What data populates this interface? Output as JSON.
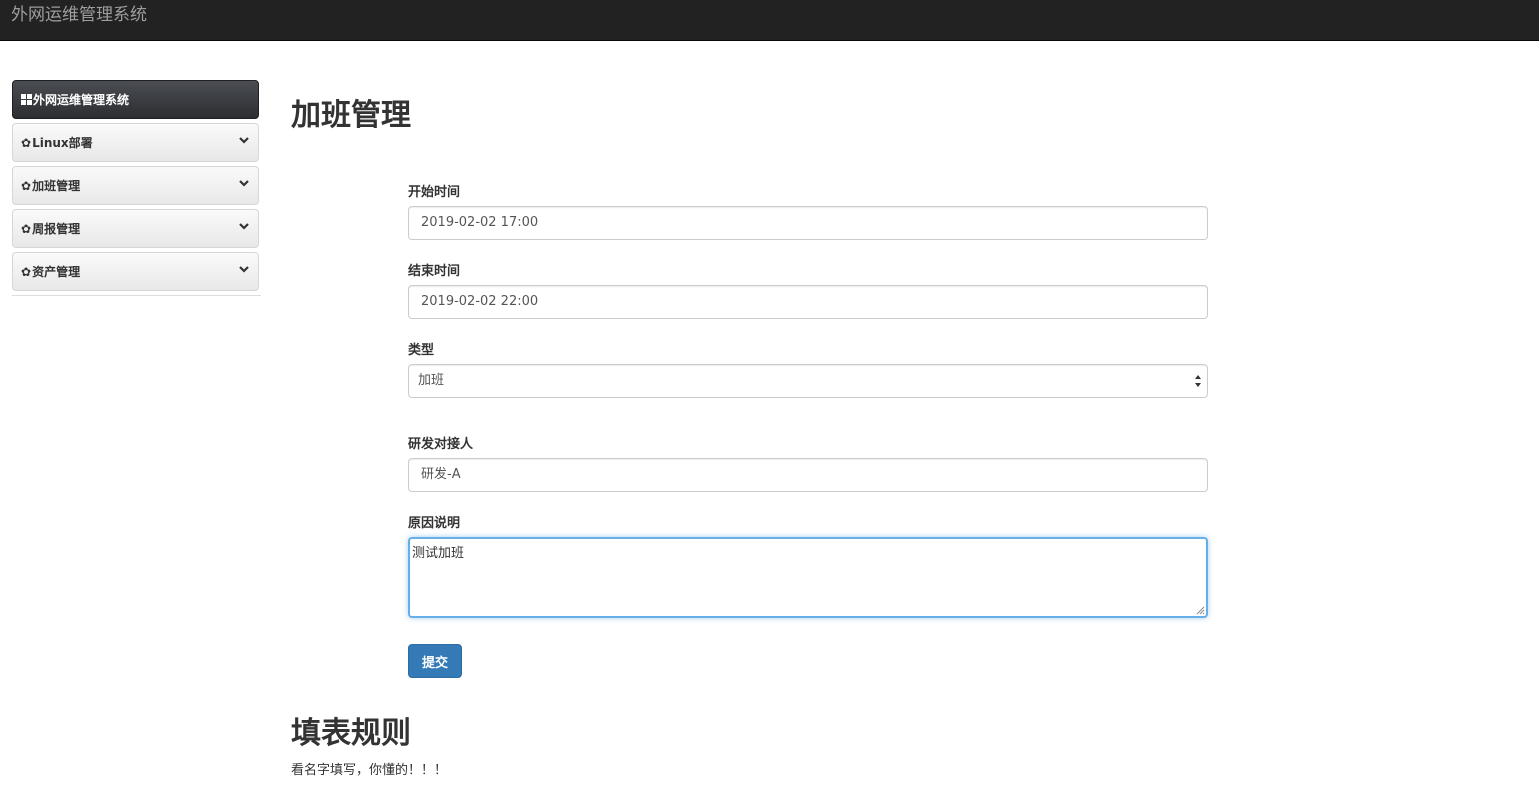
{
  "navbar": {
    "brand": "外网运维管理系统"
  },
  "sidebar": {
    "header": {
      "icon": "grid-icon",
      "label": "外网运维管理系统"
    },
    "items": [
      {
        "icon": "gear-icon",
        "label": "Linux部署",
        "chevron": "chevron-down-icon"
      },
      {
        "icon": "gear-icon",
        "label": "加班管理",
        "chevron": "chevron-down-icon"
      },
      {
        "icon": "gear-icon",
        "label": "周报管理",
        "chevron": "chevron-down-icon"
      },
      {
        "icon": "gear-icon",
        "label": "资产管理",
        "chevron": "chevron-down-icon"
      }
    ]
  },
  "main": {
    "title": "加班管理",
    "form": {
      "start_time": {
        "label": "开始时间",
        "value": "2019-02-02 17:00"
      },
      "end_time": {
        "label": "结束时间",
        "value": "2019-02-02 22:00"
      },
      "type": {
        "label": "类型",
        "selected": "加班"
      },
      "dev_contact": {
        "label": "研发对接人",
        "value": "研发-A"
      },
      "reason": {
        "label": "原因说明",
        "value": "测试加班"
      },
      "submit_label": "提交"
    },
    "rules": {
      "title": "填表规则",
      "text": "看名字填写，你懂的！！！"
    }
  },
  "colors": {
    "navbar_bg": "#222222",
    "primary": "#337ab7",
    "focus": "#66afe9"
  }
}
